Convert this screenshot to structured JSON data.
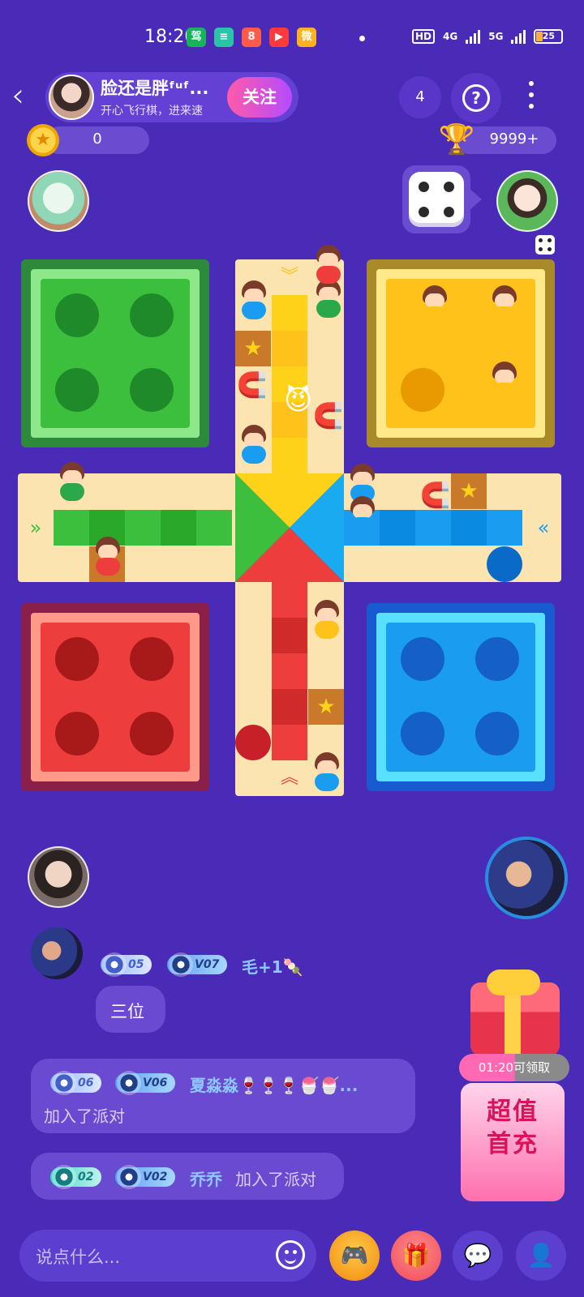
{
  "status_bar": {
    "time": "18:20",
    "network_hd": "HD",
    "network_4g": "4G",
    "network_5g": "5G",
    "battery": "25",
    "apps": [
      "驾",
      "≡",
      "8",
      "▶",
      "微"
    ]
  },
  "header": {
    "host_name": "脸还是胖ᶠᵘᶠ...",
    "host_desc": "开心飞行棋，进来速",
    "follow_label": "关注",
    "online_count": "4",
    "help_label": "?"
  },
  "scores": {
    "coins": "0",
    "trophy": "9999+"
  },
  "board": {
    "colors": {
      "green": "#3cbf3c",
      "yellow": "#ffc21a",
      "red": "#ee3d3d",
      "blue": "#1a9cf0",
      "track": "#fbe4b0"
    }
  },
  "chat": [
    {
      "level": "05",
      "vip": "V07",
      "name": "毛+1🍡",
      "text": "三位"
    },
    {
      "level": "06",
      "vip": "V06",
      "name": "夏淼淼🍷🍷🍷🍧🍧...",
      "text": "加入了派对"
    },
    {
      "level": "02",
      "vip": "V02",
      "name": "乔乔",
      "text": "加入了派对"
    }
  ],
  "promo": {
    "timer": "01:20可领取",
    "line1": "超值",
    "line2": "首充"
  },
  "input": {
    "placeholder": "说点什么..."
  }
}
